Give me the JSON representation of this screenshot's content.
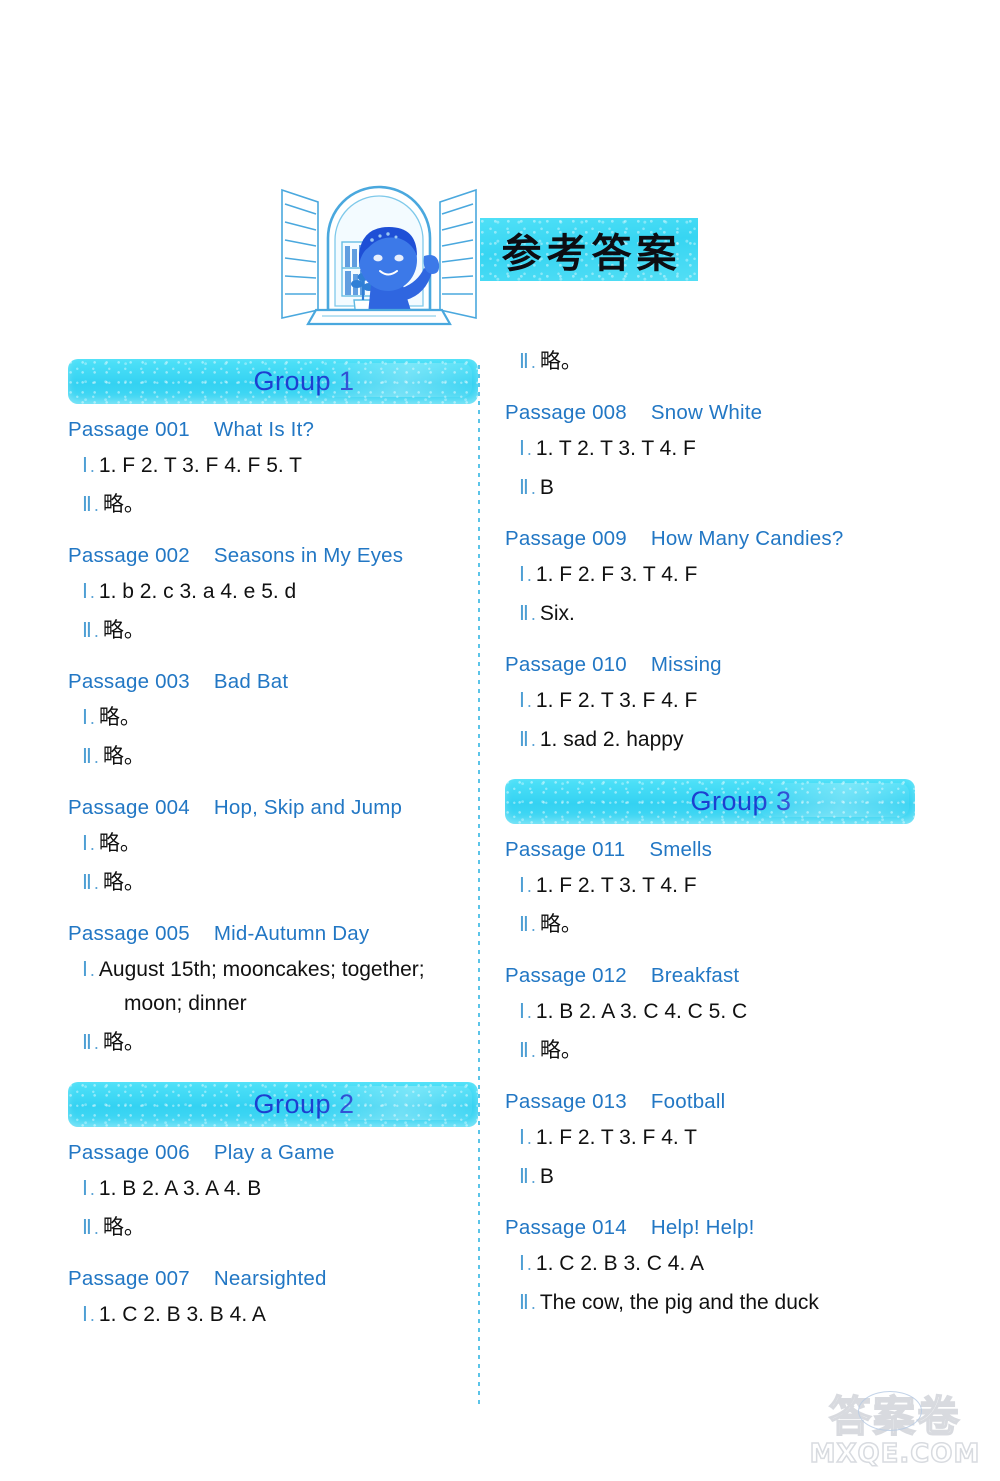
{
  "header": {
    "banner_text": "参考答案",
    "illustration_name": "child-at-window-illustration"
  },
  "watermark": {
    "cn": "答案卷",
    "en": "MXQE.COM"
  },
  "columns": {
    "left": [
      {
        "kind": "group",
        "label": "Group 1"
      },
      {
        "kind": "passage",
        "id": "Passage 001",
        "title": "What Is It?",
        "answers": [
          {
            "numeral": "Ⅰ",
            "text": "1. F  2. T  3. F  4. F  5. T"
          },
          {
            "numeral": "Ⅱ",
            "text": "略。"
          }
        ]
      },
      {
        "kind": "passage",
        "id": "Passage 002",
        "title": "Seasons in My Eyes",
        "answers": [
          {
            "numeral": "Ⅰ",
            "text": "1. b  2. c  3. a  4. e  5. d"
          },
          {
            "numeral": "Ⅱ",
            "text": "略。"
          }
        ]
      },
      {
        "kind": "passage",
        "id": "Passage 003",
        "title": "Bad Bat",
        "answers": [
          {
            "numeral": "Ⅰ",
            "text": "略。"
          },
          {
            "numeral": "Ⅱ",
            "text": "略。"
          }
        ]
      },
      {
        "kind": "passage",
        "id": "Passage 004",
        "title": "Hop, Skip and Jump",
        "answers": [
          {
            "numeral": "Ⅰ",
            "text": "略。"
          },
          {
            "numeral": "Ⅱ",
            "text": "略。"
          }
        ]
      },
      {
        "kind": "passage",
        "id": "Passage 005",
        "title": "Mid-Autumn Day",
        "answers": [
          {
            "numeral": "Ⅰ",
            "text": "August 15th; mooncakes; together;",
            "continuation": "moon; dinner"
          },
          {
            "numeral": "Ⅱ",
            "text": "略。"
          }
        ]
      },
      {
        "kind": "group",
        "label": "Group 2"
      },
      {
        "kind": "passage",
        "id": "Passage 006",
        "title": "Play a Game",
        "answers": [
          {
            "numeral": "Ⅰ",
            "text": "1. B  2. A  3. A  4. B"
          },
          {
            "numeral": "Ⅱ",
            "text": "略。"
          }
        ]
      },
      {
        "kind": "passage",
        "id": "Passage 007",
        "title": "Nearsighted",
        "answers": [
          {
            "numeral": "Ⅰ",
            "text": "1. C  2. B  3. B  4. A"
          }
        ]
      }
    ],
    "right": [
      {
        "kind": "orphan",
        "answers": [
          {
            "numeral": "Ⅱ",
            "text": "略。"
          }
        ]
      },
      {
        "kind": "passage",
        "id": "Passage 008",
        "title": "Snow White",
        "answers": [
          {
            "numeral": "Ⅰ",
            "text": "1. T  2. T  3. T  4. F"
          },
          {
            "numeral": "Ⅱ",
            "text": "B"
          }
        ]
      },
      {
        "kind": "passage",
        "id": "Passage 009",
        "title": "How Many Candies?",
        "answers": [
          {
            "numeral": "Ⅰ",
            "text": "1. F  2. F  3. T  4. F"
          },
          {
            "numeral": "Ⅱ",
            "text": "Six."
          }
        ]
      },
      {
        "kind": "passage",
        "id": "Passage 010",
        "title": "Missing",
        "answers": [
          {
            "numeral": "Ⅰ",
            "text": "1. F  2. T  3. F  4. F"
          },
          {
            "numeral": "Ⅱ",
            "text": "1. sad   2. happy"
          }
        ]
      },
      {
        "kind": "group",
        "label": "Group 3"
      },
      {
        "kind": "passage",
        "id": "Passage 011",
        "title": "Smells",
        "answers": [
          {
            "numeral": "Ⅰ",
            "text": "1. F  2. T  3. T   4. F"
          },
          {
            "numeral": "Ⅱ",
            "text": "略。"
          }
        ]
      },
      {
        "kind": "passage",
        "id": "Passage 012",
        "title": "Breakfast",
        "answers": [
          {
            "numeral": "Ⅰ",
            "text": "1. B  2. A  3. C  4. C  5. C"
          },
          {
            "numeral": "Ⅱ",
            "text": "略。"
          }
        ]
      },
      {
        "kind": "passage",
        "id": "Passage 013",
        "title": "Football",
        "answers": [
          {
            "numeral": "Ⅰ",
            "text": "1. F  2. T  3. F  4. T"
          },
          {
            "numeral": "Ⅱ",
            "text": "B"
          }
        ]
      },
      {
        "kind": "passage",
        "id": "Passage 014",
        "title": "Help! Help!",
        "answers": [
          {
            "numeral": "Ⅰ",
            "text": "1. C  2. B  3. C   4. A"
          },
          {
            "numeral": "Ⅱ",
            "text": "The cow, the pig and the duck"
          }
        ]
      }
    ]
  }
}
